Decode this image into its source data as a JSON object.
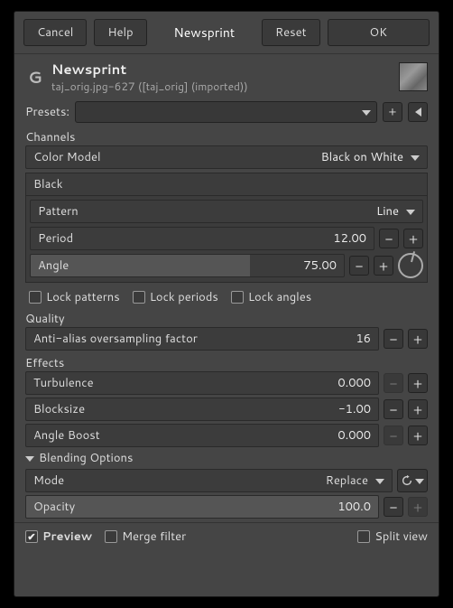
{
  "buttons": {
    "cancel": "Cancel",
    "help": "Help",
    "title": "Newsprint",
    "reset": "Reset",
    "ok": "OK"
  },
  "header": {
    "title": "Newsprint",
    "sub": "taj_orig.jpg-627 ([taj_orig] (imported))"
  },
  "presets": {
    "label": "Presets:"
  },
  "channels": {
    "title": "Channels",
    "colorModel": {
      "label": "Color Model",
      "value": "Black on White"
    },
    "tab": "Black",
    "pattern": {
      "label": "Pattern",
      "value": "Line"
    },
    "period": {
      "label": "Period",
      "value": "12.00"
    },
    "angle": {
      "label": "Angle",
      "value": "75.00"
    },
    "lockPatterns": "Lock patterns",
    "lockPeriods": "Lock periods",
    "lockAngles": "Lock angles"
  },
  "quality": {
    "title": "Quality",
    "aa": {
      "label": "Anti-alias oversampling factor",
      "value": "16"
    }
  },
  "effects": {
    "title": "Effects",
    "turbulence": {
      "label": "Turbulence",
      "value": "0.000"
    },
    "blocksize": {
      "label": "Blocksize",
      "value": "-1.00"
    },
    "angleBoost": {
      "label": "Angle Boost",
      "value": "0.000"
    }
  },
  "blending": {
    "title": "Blending Options",
    "mode": {
      "label": "Mode",
      "value": "Replace"
    },
    "opacity": {
      "label": "Opacity",
      "value": "100.0"
    }
  },
  "footer": {
    "preview": "Preview",
    "mergeFilter": "Merge filter",
    "splitView": "Split view"
  }
}
